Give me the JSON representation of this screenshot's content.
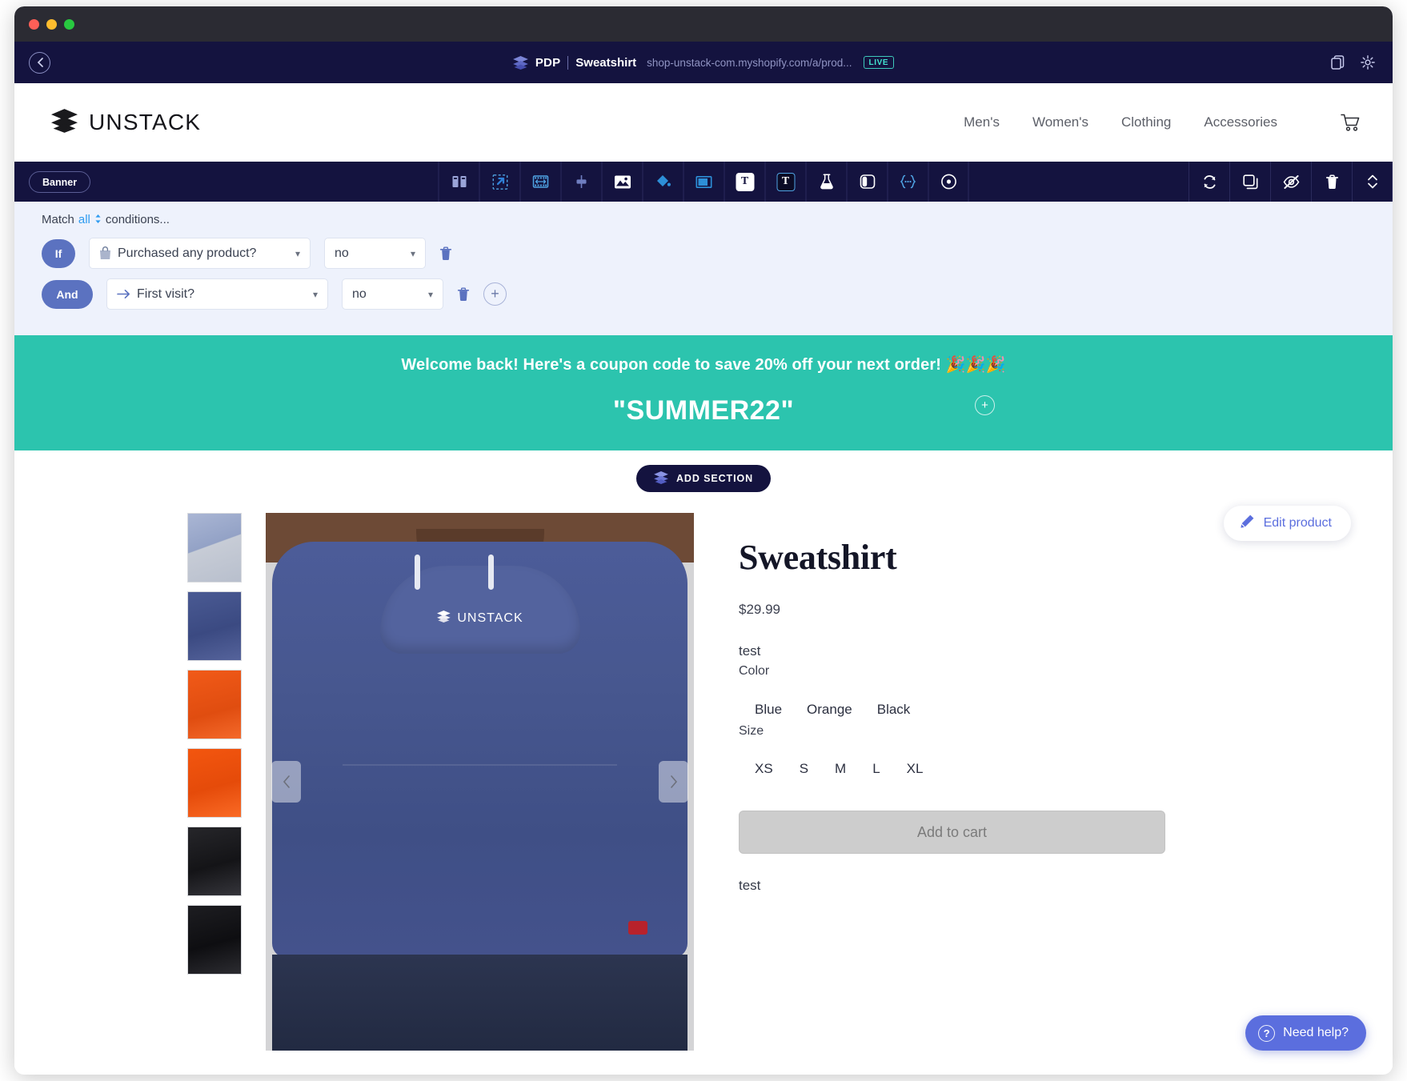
{
  "window": {
    "traffic_lights": [
      "close",
      "minimize",
      "zoom"
    ]
  },
  "appbar": {
    "back_icon": "chevron-left-icon",
    "logo_icon": "unstack-layers-icon",
    "crumb_type": "PDP",
    "crumb_name": "Sweatshirt",
    "url": "shop-unstack-com.myshopify.com/a/prod...",
    "live_badge": "LIVE",
    "right_icons": [
      "copy-icon",
      "gear-icon"
    ]
  },
  "store_nav": {
    "brand": "UNSTACK",
    "brand_icon": "unstack-layers-icon",
    "links": [
      "Men's",
      "Women's",
      "Clothing",
      "Accessories"
    ],
    "cart_icon": "shopping-cart-icon"
  },
  "toolbar": {
    "section_pill": "Banner",
    "tools": [
      {
        "name": "columns-icon",
        "glyph": "columns"
      },
      {
        "name": "resize-icon",
        "glyph": "resize"
      },
      {
        "name": "film-strip-icon",
        "glyph": "film"
      },
      {
        "name": "spacer-icon",
        "glyph": "spacer"
      },
      {
        "name": "image-icon",
        "glyph": "image"
      },
      {
        "name": "paint-bucket-icon",
        "glyph": "bucket"
      },
      {
        "name": "container-icon",
        "glyph": "container"
      },
      {
        "name": "text-light-icon",
        "glyph": "T-light"
      },
      {
        "name": "text-dark-icon",
        "glyph": "T-dark"
      },
      {
        "name": "experiment-flask-icon",
        "glyph": "flask"
      },
      {
        "name": "split-panel-icon",
        "glyph": "split"
      },
      {
        "name": "code-braces-icon",
        "glyph": "{...}"
      },
      {
        "name": "target-icon",
        "glyph": "target"
      }
    ],
    "right_tools": [
      {
        "name": "sync-icon"
      },
      {
        "name": "duplicate-icon"
      },
      {
        "name": "hide-eye-icon"
      },
      {
        "name": "delete-trash-icon"
      },
      {
        "name": "move-updown-icon"
      }
    ]
  },
  "conditions": {
    "match_prefix": "Match",
    "match_value": "all",
    "match_suffix": "conditions...",
    "rows": [
      {
        "tag": "If",
        "field": "Purchased any product?",
        "field_icon": "shopping-bag-icon",
        "value": "no",
        "has_add": false
      },
      {
        "tag": "And",
        "field": "First visit?",
        "field_icon": "arrow-right-icon",
        "value": "no",
        "has_add": true
      }
    ]
  },
  "promo": {
    "headline": "Welcome back! Here's a coupon code to save 20% off your next order! 🎉🎉🎉",
    "code": "\"SUMMER22\"",
    "add_icon": "plus-icon",
    "bg_color": "#2cc4ae"
  },
  "add_section": {
    "label": "ADD SECTION",
    "icon": "unstack-layers-icon"
  },
  "edit_product": {
    "label": "Edit product",
    "icon": "pencil-icon"
  },
  "product": {
    "title": "Sweatshirt",
    "price": "$29.99",
    "description_top": "test",
    "color_label": "Color",
    "colors": [
      "Blue",
      "Orange",
      "Black"
    ],
    "size_label": "Size",
    "sizes": [
      "XS",
      "S",
      "M",
      "L",
      "XL"
    ],
    "add_to_cart": "Add to cart",
    "description_bottom": "test",
    "gallery_prev_icon": "chevron-left-icon",
    "gallery_next_icon": "chevron-right-icon",
    "hero_logo": "UNSTACK",
    "thumbnails": [
      "light-blue-hoodie",
      "navy-hoodie",
      "orange-hoodie-front",
      "orange-hoodie-back",
      "black-hoodie-front",
      "black-hoodie-back"
    ]
  },
  "need_help": {
    "label": "Need help?",
    "icon": "question-circle-icon"
  }
}
